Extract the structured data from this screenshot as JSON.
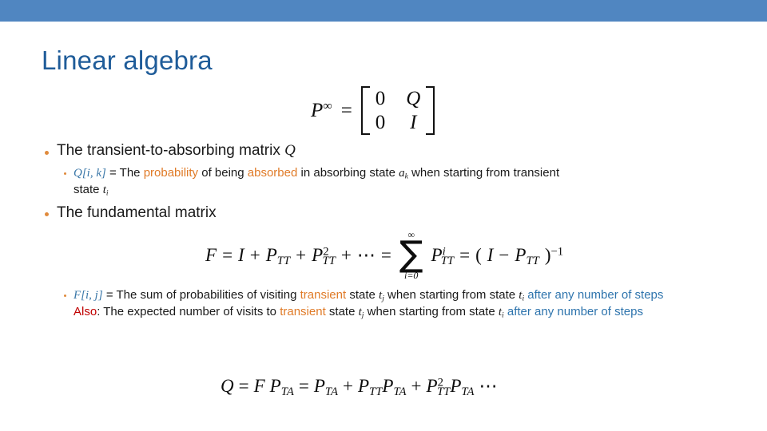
{
  "slide": {
    "title": "Linear algebra",
    "accent_bar_color": "#5086c1",
    "title_color": "#1f5c99",
    "bullet_color": "#e08a3c",
    "background": "#ffffff"
  },
  "formula_pinf": {
    "lhs": "P",
    "lhs_sup": "∞",
    "equals": "=",
    "cells": [
      "0",
      "Q",
      "0",
      "I"
    ]
  },
  "bullets": [
    {
      "level": 1,
      "text_plain": "The transient-to-absorbing matrix",
      "math_tail": "Q"
    },
    {
      "level": 2,
      "segments": [
        {
          "text": "Q[i, k]",
          "color": "#3a77a8",
          "style": "math"
        },
        {
          "text": " = The ",
          "color": "#1a1a1a",
          "style": "plain"
        },
        {
          "text": "probability",
          "color": "#e07b28",
          "style": "plain"
        },
        {
          "text": " of being ",
          "color": "#1a1a1a",
          "style": "plain"
        },
        {
          "text": "absorbed",
          "color": "#e07b28",
          "style": "plain"
        },
        {
          "text": " in absorbing state ",
          "color": "#1a1a1a",
          "style": "plain"
        },
        {
          "text": "a_k",
          "color": "#1a1a1a",
          "style": "math"
        },
        {
          "text": " when starting from transient state ",
          "color": "#1a1a1a",
          "style": "plain"
        },
        {
          "text": "t_i",
          "color": "#1a1a1a",
          "style": "math"
        }
      ]
    },
    {
      "level": 1,
      "text_plain": "The fundamental matrix",
      "math_tail": ""
    }
  ],
  "bullet2_parts": {
    "p1": "Q[i, k]",
    "p2": " = The ",
    "p3": "probability",
    "p4": " of being ",
    "p5": "absorbed",
    "p6": " in absorbing state ",
    "p7": "a",
    "p7sub": "k",
    "p8": " when starting from transient",
    "p9": "state ",
    "p10": "t",
    "p10sub": "i"
  },
  "formula_F": {
    "F": "F",
    "eq1": "=",
    "I": "I",
    "plus1": "+",
    "P1": "P",
    "P1sub": "TT",
    "plus2": "+",
    "P2": "P",
    "P2sub": "TT",
    "P2sup": "2",
    "plus3": "+",
    "dots": "⋯",
    "eq2": "=",
    "sum_glyph": "∑",
    "sum_upper": "∞",
    "sum_lower": "i=0",
    "P3": "P",
    "P3sub": "TT",
    "P3sup": "i",
    "eq3": "=",
    "open": "(",
    "I2": "I",
    "minus": "−",
    "P4": "P",
    "P4sub": "TT",
    "close": ")",
    "invsup": "−1"
  },
  "bullet_F_block": {
    "line1_a": "F[i, j]",
    "line1_b": " = The sum of probabilities of visiting ",
    "line1_c": "transient",
    "line1_d": " state ",
    "line1_e": "t",
    "line1_e_sub": "j",
    "line1_f": " when starting from state ",
    "line1_g": "t",
    "line1_g_sub": "i",
    "line1_h": " after any number of steps",
    "line2_a": "Also",
    "line2_b": ": The expected number of visits to ",
    "line2_c": "transient",
    "line2_d": " state ",
    "line2_e": "t",
    "line2_e_sub": "j",
    "line2_f": " when starting from state ",
    "line2_g": "t",
    "line2_g_sub": "i",
    "line2_h": " after any number of steps"
  },
  "formula_Q": {
    "Q": "Q",
    "eq1": "=",
    "F": "F",
    "P1": "P",
    "P1sub": "TA",
    "eq2": "=",
    "P2": "P",
    "P2sub": "TA",
    "plus1": "+",
    "P3": "P",
    "P3sub": "TT",
    "P4": "P",
    "P4sub": "TA",
    "plus2": "+",
    "P5": "P",
    "P5sub": "TT",
    "P5sup": "2",
    "P6": "P",
    "P6sub": "TA",
    "dots": "⋯"
  }
}
